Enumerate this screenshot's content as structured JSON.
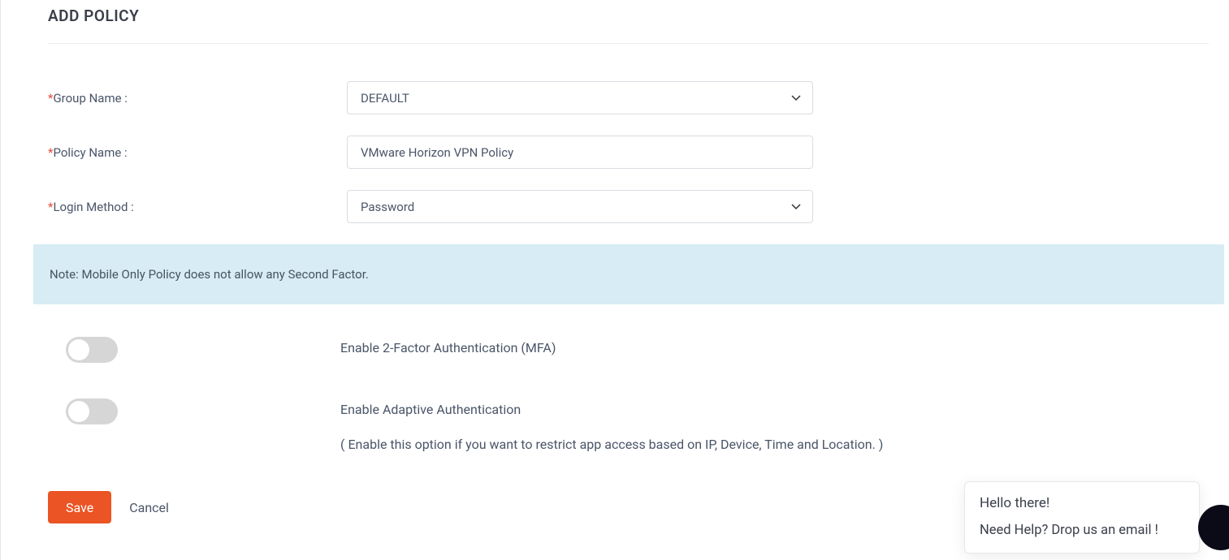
{
  "title": "ADD POLICY",
  "form": {
    "group_name_label": "Group Name :",
    "group_name_value": "DEFAULT",
    "policy_name_label": "Policy Name :",
    "policy_name_value": "VMware Horizon VPN Policy",
    "login_method_label": "Login Method :",
    "login_method_value": "Password"
  },
  "note": "Note: Mobile Only Policy does not allow any Second Factor.",
  "toggles": {
    "mfa_label": "Enable 2-Factor Authentication (MFA)",
    "adaptive_label": "Enable Adaptive Authentication",
    "adaptive_hint": "( Enable this option if you want to restrict app access based on IP, Device, Time and Location. )"
  },
  "actions": {
    "save": "Save",
    "cancel": "Cancel"
  },
  "help": {
    "greeting": "Hello there!",
    "prompt": "Need Help? Drop us an email !"
  }
}
